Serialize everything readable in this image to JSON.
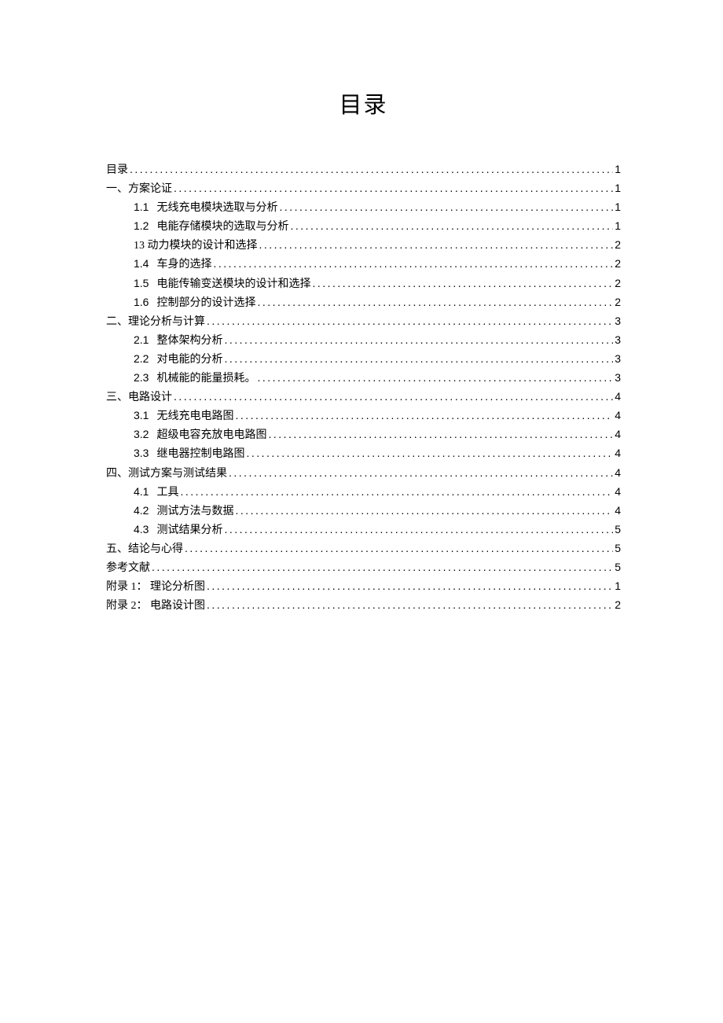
{
  "title": "目录",
  "toc": [
    {
      "level": 1,
      "num": "",
      "text": "目录",
      "page": "1"
    },
    {
      "level": 1,
      "num": "",
      "text": "一、方案论证",
      "page": "1"
    },
    {
      "level": 2,
      "num": "1.1",
      "text": "无线充电模块选取与分析",
      "page": "1"
    },
    {
      "level": 2,
      "num": "1.2",
      "text": "电能存储模块的选取与分析",
      "page": "1"
    },
    {
      "level": 2,
      "num": "",
      "text": "13 动力模块的设计和选择 ",
      "page": "2"
    },
    {
      "level": 2,
      "num": "1.4",
      "text": "车身的选择",
      "page": "2"
    },
    {
      "level": 2,
      "num": "1.5",
      "text": "电能传输变送模块的设计和选择",
      "page": "2"
    },
    {
      "level": 2,
      "num": "1.6",
      "text": "控制部分的设计选择",
      "page": "2"
    },
    {
      "level": 1,
      "num": "",
      "text": "二、理论分析与计算",
      "page": "3"
    },
    {
      "level": 2,
      "num": "2.1",
      "text": "整体架构分析",
      "page": "3"
    },
    {
      "level": 2,
      "num": "2.2",
      "text": "对电能的分析",
      "page": "3"
    },
    {
      "level": 2,
      "num": "2.3",
      "text": "机械能的能量损耗。",
      "page": "3"
    },
    {
      "level": 1,
      "num": "",
      "text": "三、电路设计",
      "page": "4"
    },
    {
      "level": 2,
      "num": "3.1",
      "text": "无线充电电路图",
      "page": "4"
    },
    {
      "level": 2,
      "num": "3.2",
      "text": "超级电容充放电电路图",
      "page": "4"
    },
    {
      "level": 2,
      "num": "3.3",
      "text": "继电器控制电路图",
      "page": "4"
    },
    {
      "level": 1,
      "num": "",
      "text": "四、测试方案与测试结果",
      "page": "4"
    },
    {
      "level": 2,
      "num": "4.1",
      "text": "工具",
      "page": "4"
    },
    {
      "level": 2,
      "num": "4.2",
      "text": "测试方法与数据",
      "page": "4"
    },
    {
      "level": 2,
      "num": "4.3",
      "text": "测试结果分析",
      "page": "5"
    },
    {
      "level": 1,
      "num": "",
      "text": "五、结论与心得",
      "page": "5"
    },
    {
      "level": 1,
      "num": "",
      "text": "参考文献",
      "page": "5"
    },
    {
      "level": 1,
      "num": "",
      "text": "附录 1： 理论分析图",
      "page": "1"
    },
    {
      "level": 1,
      "num": "",
      "text": "附录 2： 电路设计图",
      "page": "2"
    }
  ]
}
